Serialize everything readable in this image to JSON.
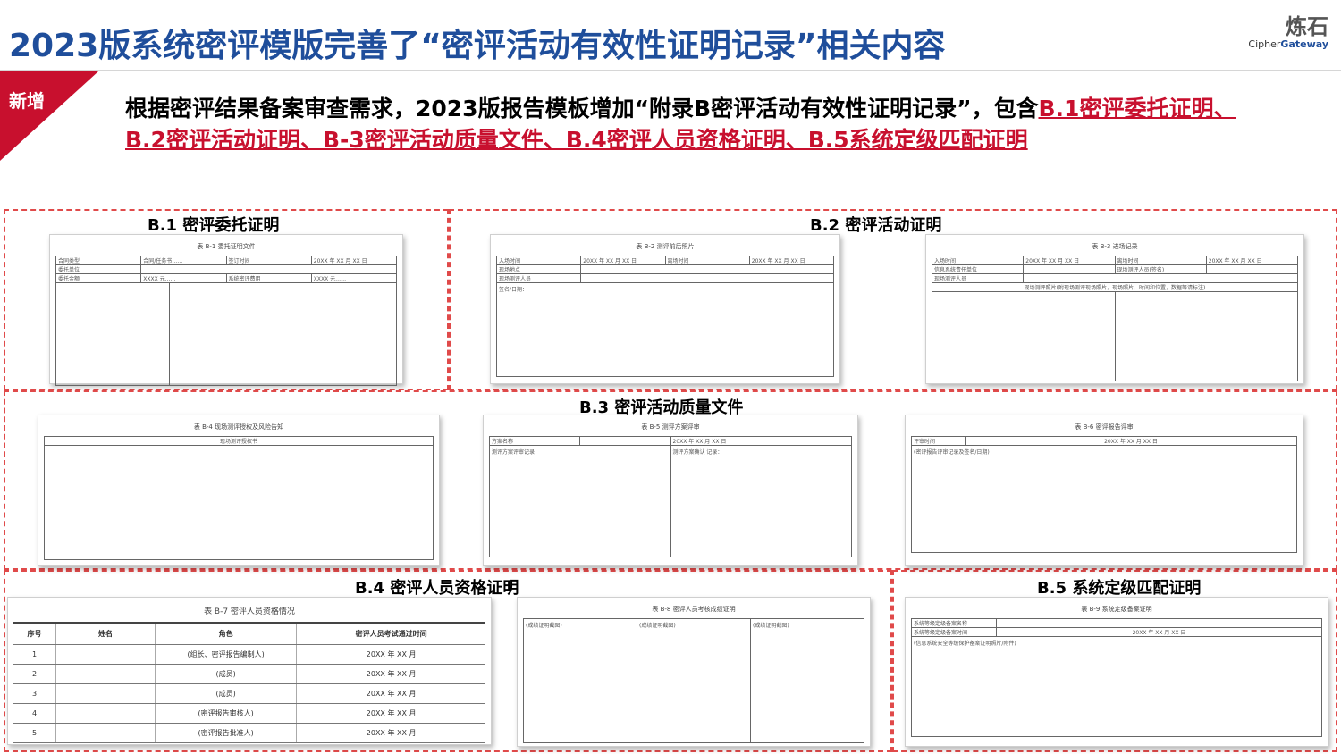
{
  "header": {
    "title": "2023版系统密评模版完善了“密评活动有效性证明记录”相关内容",
    "logo_cn": "炼石",
    "logo_en_prefix": "Cipher",
    "logo_en_suffix": "Gateway"
  },
  "ribbon": {
    "label": "新增"
  },
  "intro": {
    "text": "根据密评结果备案审查需求，2023版报告模板增加“附录B密评活动有效性证明记录”，包含",
    "highlight": "B.1密评委托证明、B.2密评活动证明、B-3密评活动质量文件、B.4密评人员资格证明、B.5系统定级匹配证明"
  },
  "sections": {
    "b1": {
      "title": "B.1 密评委托证明"
    },
    "b2": {
      "title": "B.2 密评活动证明"
    },
    "b3": {
      "title": "B.3 密评活动质量文件"
    },
    "b4": {
      "title": "B.4 密评人员资格证明"
    },
    "b5": {
      "title": "B.5 系统定级匹配证明"
    }
  },
  "docs": {
    "d1": {
      "caption": "表 B-1 委托证明文件",
      "r1": [
        "合同类型",
        "合同/任务书……",
        "签订时间",
        "20XX 年 XX 月 XX 日"
      ],
      "r2": [
        "委托单位",
        ""
      ],
      "r3": [
        "委托金额",
        "XXXX 元……",
        "系统密评费用",
        "XXXX 元……"
      ]
    },
    "d2": {
      "caption": "表 B-2 测评前后照片",
      "r1": [
        "入场时间",
        "20XX 年 XX 月 XX 日",
        "离场时间",
        "20XX 年 XX 月 XX 日"
      ],
      "r2": [
        "现场地点",
        ""
      ],
      "r3": [
        "现场测评人员",
        ""
      ],
      "note": "签名/日期："
    },
    "d3": {
      "caption": "表 B-3 进场记录",
      "r1": [
        "入场时间",
        "20XX 年 XX 月 XX 日",
        "离场时间",
        "20XX 年 XX 月 XX 日"
      ],
      "r2": [
        "信息系统责任单位",
        "现场测评人员(签名)"
      ],
      "r3": [
        "现场测评人员",
        ""
      ],
      "r4": "现场测评照片(附现场测评现场照片，现场照片、时间和位置，数据等请标注)"
    },
    "d4": {
      "caption": "表 B-4 现场测评授权及风险告知",
      "r1": "现场测评授权书"
    },
    "d5": {
      "caption": "表 B-5 测评方案评审",
      "r1": [
        "方案名称",
        "",
        "20XX 年 XX 月 XX 日"
      ],
      "left": "测评方案评审记录：",
      "right": "测评方案确认 记录："
    },
    "d6": {
      "caption": "表 B-6 密评报告评审",
      "r1": [
        "评审时间",
        "20XX 年 XX 月 XX 日"
      ],
      "note": "(密评报告评审记录及签名/日期)"
    },
    "d7": {
      "caption": "表 B-7 密评人员资格情况",
      "headers": [
        "序号",
        "姓名",
        "角色",
        "密评人员考试通过时间"
      ],
      "rows": [
        [
          "1",
          "",
          "(组长、密评报告编制人)",
          "20XX 年 XX 月"
        ],
        [
          "2",
          "",
          "(成员)",
          "20XX 年 XX 月"
        ],
        [
          "3",
          "",
          "(成员)",
          "20XX 年 XX 月"
        ],
        [
          "4",
          "",
          "(密评报告审核人)",
          "20XX 年 XX 月"
        ],
        [
          "5",
          "",
          "(密评报告批准人)",
          "20XX 年 XX 月"
        ]
      ]
    },
    "d8": {
      "caption": "表 B-8 密评人员考核成绩证明",
      "cells": [
        "(成绩证明截图)",
        "(成绩证明截图)",
        "(成绩证明截图)"
      ]
    },
    "d9": {
      "caption": "表 B-9 系统定级备案证明",
      "r1": [
        "系统等级定级备案名称",
        ""
      ],
      "r2": [
        "系统等级定级备案时间",
        "20XX 年 XX 月 XX 日"
      ],
      "note": "(信息系统安全等级保护备案证明照片/附件)"
    }
  }
}
